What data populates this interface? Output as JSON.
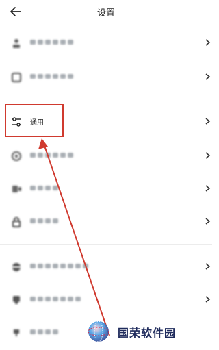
{
  "header": {
    "title": "设置",
    "back_icon": "arrow-left-icon"
  },
  "rows": [
    {
      "icon": "user-icon",
      "label": ""
    },
    {
      "icon": "square-icon",
      "label": ""
    },
    {
      "icon": "sliders-icon",
      "label": "通用"
    },
    {
      "icon": "circle-icon",
      "label": ""
    },
    {
      "icon": "phone-icon",
      "label": ""
    },
    {
      "icon": "lock-icon",
      "label": ""
    },
    {
      "icon": "ring-icon",
      "label": ""
    },
    {
      "icon": "shield-icon",
      "label": ""
    },
    {
      "icon": "cloud-icon",
      "label": ""
    }
  ],
  "annotation": {
    "color": "#d03a2f",
    "highlighted_row": "通用"
  },
  "watermark": {
    "text": "国荣软件园",
    "color": "#1f2b5c"
  }
}
